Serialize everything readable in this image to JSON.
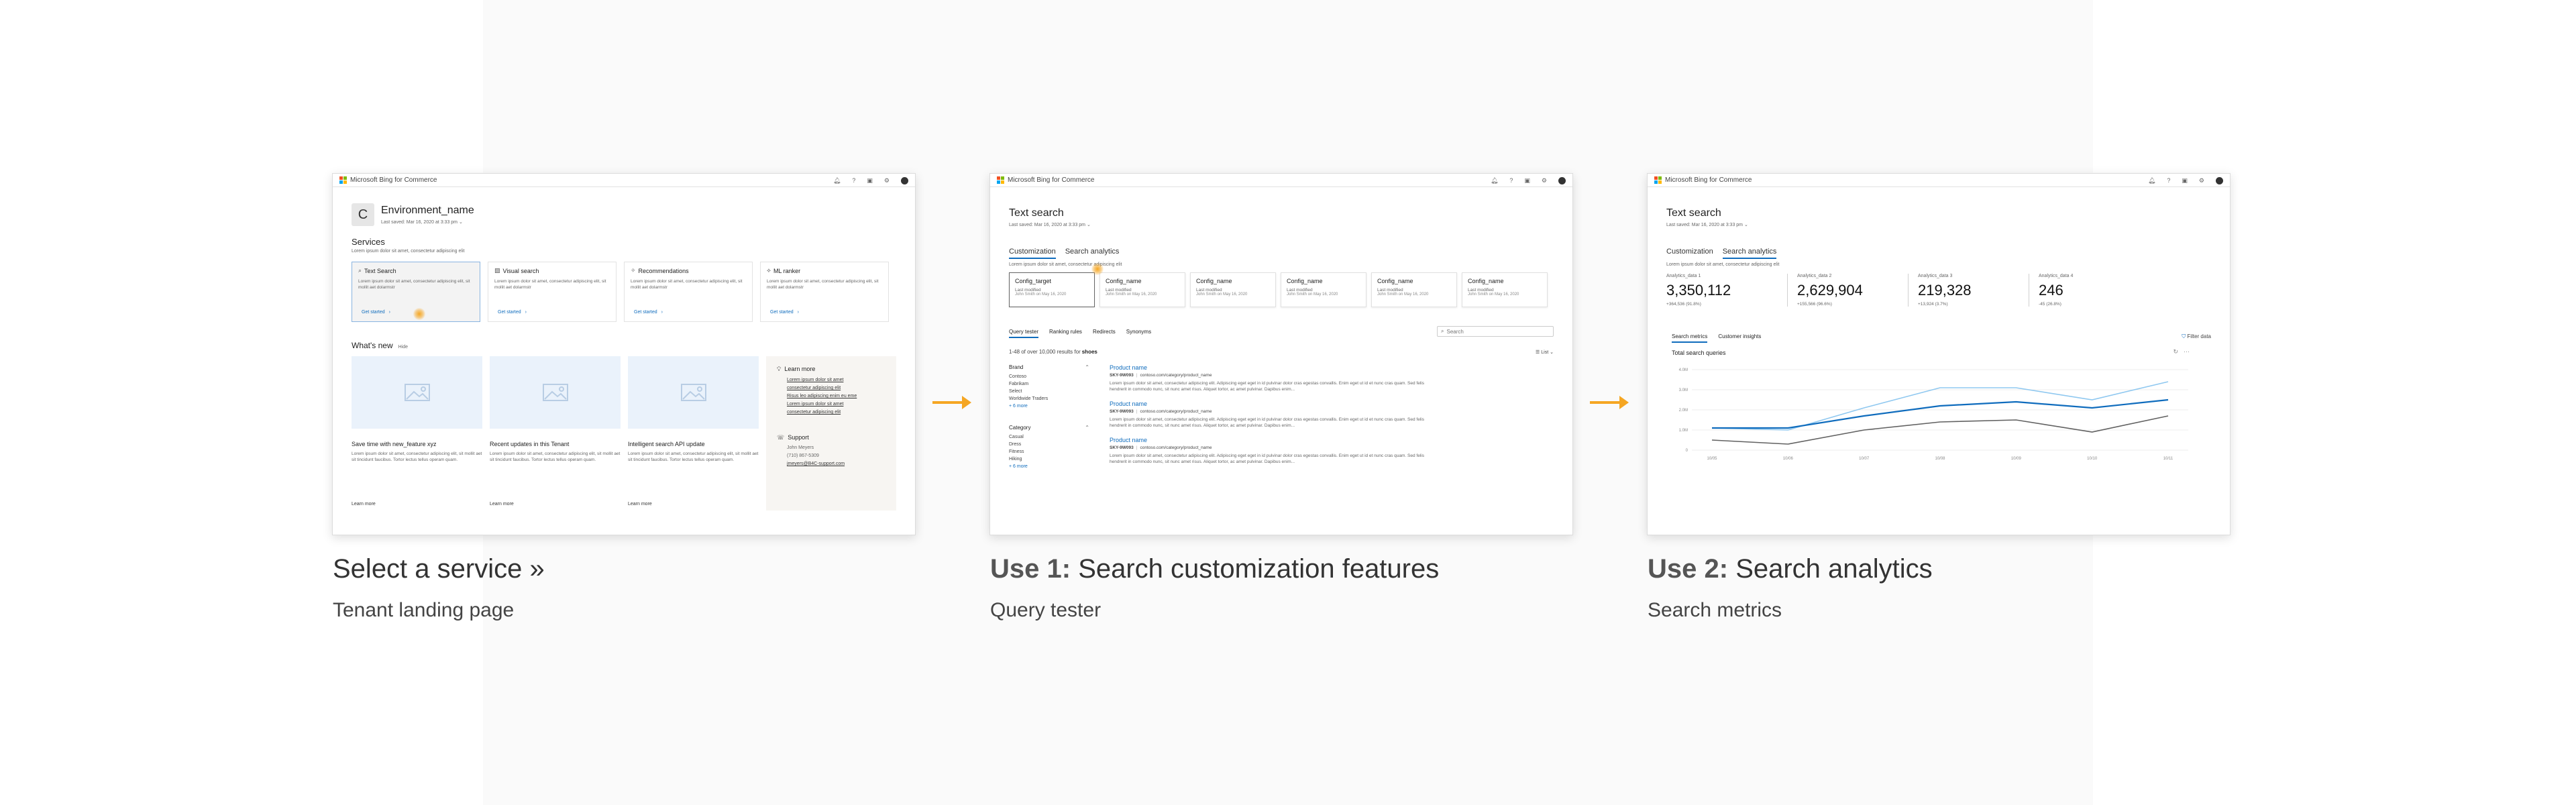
{
  "brand": {
    "name": "Microsoft Bing for Commerce",
    "logo_colors": [
      "#f25022",
      "#7fba00",
      "#00a4ef",
      "#ffb900"
    ],
    "accent": "#0f6cbd",
    "arrow_color": "#f5a623"
  },
  "topbar_icons": [
    "bell-icon",
    "help-icon",
    "inbox-icon",
    "gear-icon",
    "avatar"
  ],
  "captions": [
    {
      "prefix": "",
      "title": "Select a service »",
      "subtitle": "Tenant landing page"
    },
    {
      "prefix": "Use 1:",
      "title": "Search customization features",
      "subtitle": "Query tester"
    },
    {
      "prefix": "Use 2:",
      "title": "Search analytics",
      "subtitle": "Search metrics"
    }
  ],
  "panel1": {
    "env_initial": "C",
    "env_name": "Environment_name",
    "last_saved": "Last saved: Mar 16, 2020 at 3:33 pm",
    "services_title": "Services",
    "services_desc": "Lorem ipsum dolor sit amet, consectetur adipiscing elit",
    "services": [
      {
        "icon": "search-icon",
        "title": "Text Search",
        "desc": "Lorem ipsum dolor sit amet, consectetur adipiscing elit, sit mollit aet dolarmstr",
        "cta": "Get started"
      },
      {
        "icon": "image-icon",
        "title": "Visual search",
        "desc": "Lorem ipsum dolor sit amet, consectetur adipiscing elit, sit mollit aet dolarmstr",
        "cta": "Get started"
      },
      {
        "icon": "star-icon",
        "title": "Recommendations",
        "desc": "Lorem ipsum dolor sit amet, consectetur adipiscing elit, sit mollit aet dolarmstr",
        "cta": "Get started"
      },
      {
        "icon": "ml-icon",
        "title": "ML ranker",
        "desc": "Lorem ipsum dolor sit amet, consectetur adipiscing elit, sit mollit aet dolarmstr",
        "cta": "Get started"
      }
    ],
    "whats_new_title": "What's new",
    "whats_new_hide": "Hide",
    "news": [
      {
        "title": "Save time with new_feature xyz",
        "body": "Lorem ipsum dolor sit amet, consectetur adipiscing elit, sit mollit aet sit tincidunt faucibus. Tortor lectus tellus operam quam.",
        "cta": "Learn more"
      },
      {
        "title": "Recent updates in this Tenant",
        "body": "Lorem ipsum dolor sit amet, consectetur adipiscing elit, sit mollit aet sit tincidunt faucibus. Tortor lectus tellus operam quam.",
        "cta": "Learn more"
      },
      {
        "title": "Intelligent search API update",
        "body": "Lorem ipsum dolor sit amet, consectetur adipiscing elit, sit mollit aet sit tincidunt faucibus. Tortor lectus tellus operam quam.",
        "cta": "Learn more"
      }
    ],
    "learn_more_title": "Learn more",
    "learn_more_links": [
      "Lorem ipsum dolor sit amet",
      "consectetur adipiscing elit",
      "Risus leo adipiscing enim eu eme",
      "Lorem ipsum dolor sit amet",
      "consectetur adipiscing elit"
    ],
    "support_title": "Support",
    "support_lines": [
      "John Meyers",
      "(710) 867-5309",
      "jmeyers@B4C-support.com"
    ]
  },
  "panel2": {
    "title": "Text search",
    "last_saved": "Last saved: Mar 16, 2020 at 3:33 pm",
    "tabs": [
      "Customization",
      "Search analytics"
    ],
    "tabs_desc": "Lorem ipsum dolor sit amet, consectetur adipiscing elit",
    "configs": [
      {
        "name": "Config_target",
        "line1": "Last modified",
        "line2": "John Smith on May 16, 2020"
      },
      {
        "name": "Config_name",
        "line1": "Last modified",
        "line2": "John Smith on May 16, 2020"
      },
      {
        "name": "Config_name",
        "line1": "Last modified",
        "line2": "John Smith on May 16, 2020"
      },
      {
        "name": "Config_name",
        "line1": "Last modified",
        "line2": "John Smith on May 16, 2020"
      },
      {
        "name": "Config_name",
        "line1": "Last modified",
        "line2": "John Smith on May 16, 2020"
      },
      {
        "name": "Config_name",
        "line1": "Last modified",
        "line2": "John Smith on May 16, 2020"
      }
    ],
    "subtabs": [
      "Query tester",
      "Ranking rules",
      "Redirects",
      "Synonyms"
    ],
    "search_placeholder": "Search",
    "results_prefix": "1-48 of over 10,000 results for ",
    "results_query": "shoes",
    "list_toggle": "List",
    "filters": [
      {
        "title": "Brand",
        "items": [
          "Contoso",
          "Fabrikam",
          "Select",
          "Worldwide Traders"
        ],
        "more": "+ 6 more"
      },
      {
        "title": "Category",
        "items": [
          "Casual",
          "Dress",
          "Fitness",
          "Hiking"
        ],
        "more": "+ 6 more"
      }
    ],
    "results": [
      {
        "title": "Product name",
        "id": "SKY-9W093",
        "url": "contoso.com/category/product_name",
        "desc": "Lorem ipsum dolor sit amet, consectetur adipiscing elit. Adipiscing eget eget in id pulvinar dolor cras egestas convallis. Enim eget ut id et nunc cras quam. Sed felis hendrerit in commodo nunc, sit nunc amet risus. Aliquet tortor, ac amet pulvinar. Dapibus enim..."
      },
      {
        "title": "Product name",
        "id": "SKY-9W093",
        "url": "contoso.com/category/product_name",
        "desc": "Lorem ipsum dolor sit amet, consectetur adipiscing elit. Adipiscing eget eget in id pulvinar dolor cras egestas convallis. Enim eget ut id et nunc cras quam. Sed felis hendrerit in commodo nunc, sit nunc amet risus. Aliquet tortor, ac amet pulvinar. Dapibus enim..."
      },
      {
        "title": "Product name",
        "id": "SKY-9W093",
        "url": "contoso.com/category/product_name",
        "desc": "Lorem ipsum dolor sit amet, consectetur adipiscing elit. Adipiscing eget eget in id pulvinar dolor cras egestas convallis. Enim eget ut id et nunc cras quam. Sed felis hendrerit in commodo nunc, sit nunc amet risus. Aliquet tortor, ac amet pulvinar. Dapibus enim..."
      }
    ]
  },
  "panel3": {
    "title": "Text search",
    "last_saved": "Last saved: Mar 16, 2020 at 3:33 pm",
    "tabs": [
      "Customization",
      "Search analytics"
    ],
    "tabs_desc": "Lorem ipsum dolor sit amet, consectetur adipiscing elit",
    "metrics": [
      {
        "label": "Analytics_data 1",
        "value": "3,350,112",
        "delta": "+364,536 (91.8%)"
      },
      {
        "label": "Analytics_data 2",
        "value": "2,629,904",
        "delta": "+155,566 (96.6%)"
      },
      {
        "label": "Analytics_data 3",
        "value": "219,328",
        "delta": "+13,924 (3.7%)"
      },
      {
        "label": "Analytics_data 4",
        "value": "246",
        "delta": "-45 (26.8%)"
      }
    ],
    "subtabs": [
      "Search metrics",
      "Customer insights"
    ],
    "filter_label": "Filter data",
    "chart_title": "Total search queries",
    "chart_more": "···"
  },
  "chart_data": {
    "type": "line",
    "title": "Total search queries",
    "x": [
      "10/05",
      "10/06",
      "10/07",
      "10/08",
      "10/09",
      "10/10",
      "10/11"
    ],
    "y_ticks": [
      "4.0M",
      "3.0M",
      "2.0M",
      "1.0M",
      "0"
    ],
    "ylim": [
      0,
      4.0
    ],
    "grid": true,
    "series": [
      {
        "color": "#8fc8f0",
        "values": [
          1.1,
          1.0,
          2.1,
          3.1,
          3.1,
          2.5,
          3.4
        ]
      },
      {
        "color": "#0f6cbd",
        "values": [
          1.1,
          1.1,
          1.7,
          2.2,
          2.4,
          2.1,
          2.5
        ]
      },
      {
        "color": "#616161",
        "values": [
          0.5,
          0.3,
          1.0,
          1.4,
          1.5,
          0.9,
          1.7
        ]
      }
    ]
  }
}
